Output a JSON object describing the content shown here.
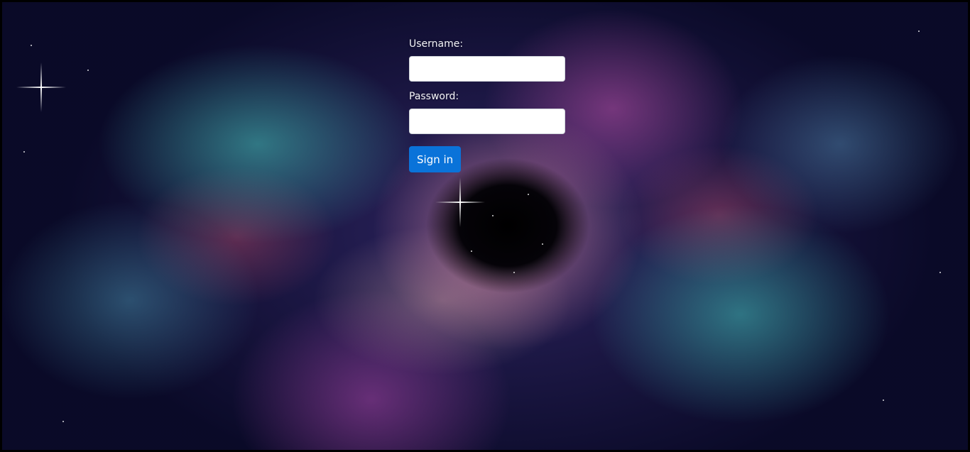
{
  "login": {
    "username_label": "Username:",
    "username_value": "",
    "password_label": "Password:",
    "password_value": "",
    "submit_label": "Sign in"
  },
  "theme": {
    "button_color": "#0a73d9",
    "label_color": "#f4f4f8"
  }
}
